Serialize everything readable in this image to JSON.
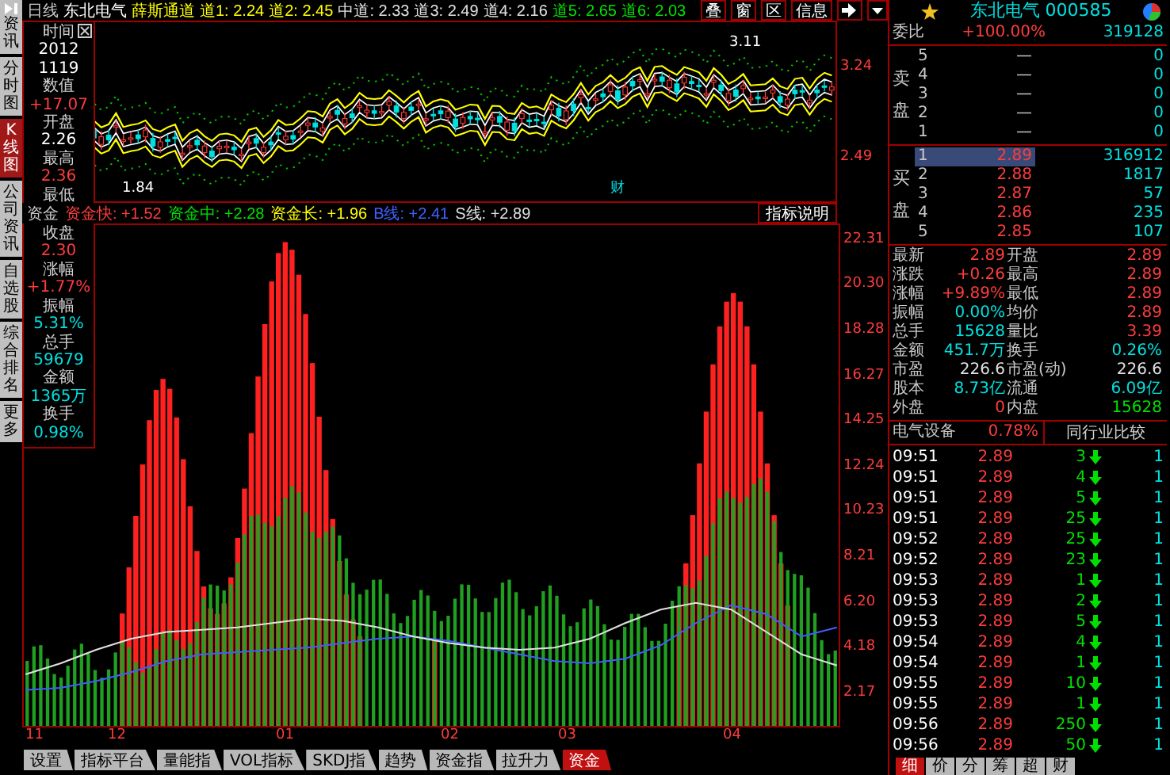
{
  "side_tabs": [
    {
      "label": "资讯",
      "icon": true,
      "selected": false
    },
    {
      "label": "分时图",
      "icon": false,
      "selected": false
    },
    {
      "label": "K线图",
      "icon": false,
      "selected": true
    },
    {
      "label": "公司资讯",
      "icon": false,
      "selected": false
    },
    {
      "label": "自选股",
      "icon": false,
      "selected": false
    },
    {
      "label": "综合排名",
      "icon": false,
      "selected": false
    },
    {
      "label": "更多",
      "icon": false,
      "selected": false
    }
  ],
  "header": {
    "period": "日线",
    "stock": "东北电气",
    "indicator": "薛斯通道",
    "values": [
      {
        "text": "道1: 2.24",
        "color": "#ffff00"
      },
      {
        "text": "道2: 2.45",
        "color": "#ffff00"
      },
      {
        "text": "中道: 2.33",
        "color": "#e0e0e0"
      },
      {
        "text": "道3: 2.49",
        "color": "#e0e0e0"
      },
      {
        "text": "道4: 2.16",
        "color": "#e0e0e0"
      },
      {
        "text": "道5: 2.65",
        "color": "#00e000"
      },
      {
        "text": "道6: 2.03",
        "color": "#00e000"
      }
    ],
    "buttons": [
      "叠",
      "窗",
      "区",
      "信息"
    ]
  },
  "price_chart": {
    "axis_labels": [
      "3.24",
      "2.49"
    ],
    "annotations": [
      {
        "kind": "high",
        "text": "3.11"
      },
      {
        "kind": "low",
        "text": "1.84"
      },
      {
        "kind": "mark",
        "text": "财"
      }
    ]
  },
  "info_panel": [
    {
      "label": "时间",
      "values": [
        {
          "text": "2012",
          "color": "#ffffff"
        },
        {
          "text": "1119",
          "color": "#ffffff"
        }
      ]
    },
    {
      "label": "数值",
      "values": [
        {
          "text": "+17.07",
          "color": "#ff3c3c"
        }
      ]
    },
    {
      "label": "开盘",
      "values": [
        {
          "text": "2.26",
          "color": "#ffffff"
        }
      ]
    },
    {
      "label": "最高",
      "values": [
        {
          "text": "2.36",
          "color": "#ff3c3c"
        }
      ]
    },
    {
      "label": "最低"
    },
    {
      "label": "收盘",
      "values": [
        {
          "text": "2.30",
          "color": "#ff3c3c"
        }
      ]
    },
    {
      "label": "涨幅",
      "values": [
        {
          "text": "+1.77%",
          "color": "#ff3c3c"
        }
      ]
    },
    {
      "label": "振幅",
      "values": [
        {
          "text": "5.31%",
          "color": "#00e0e0"
        }
      ]
    },
    {
      "label": "总手",
      "values": [
        {
          "text": "59679",
          "color": "#00e0e0"
        }
      ]
    },
    {
      "label": "金额",
      "values": [
        {
          "text": "1365万",
          "color": "#00e0e0"
        }
      ]
    },
    {
      "label": "换手",
      "values": [
        {
          "text": "0.98%",
          "color": "#00e0e0"
        }
      ]
    }
  ],
  "indicator_bar": {
    "name": "资金",
    "values": [
      {
        "text": "资金快: +1.52",
        "color": "#ff3c3c"
      },
      {
        "text": "资金中: +2.28",
        "color": "#00e000"
      },
      {
        "text": "资金长: +1.96",
        "color": "#ffff00"
      }
    ],
    "button": "指标说明"
  },
  "indicator_chart": {
    "chart_data": {
      "type": "line",
      "ylim": [
        0.6,
        23.0
      ],
      "yticks": [
        {
          "value": 22.31,
          "label": "22.31"
        },
        {
          "value": 20.3,
          "label": "20.30"
        },
        {
          "value": 18.28,
          "label": "18.28"
        },
        {
          "value": 16.27,
          "label": "16.27"
        },
        {
          "value": 14.25,
          "label": "14.25"
        },
        {
          "value": 12.24,
          "label": "12.24"
        },
        {
          "value": 10.23,
          "label": "10.23"
        },
        {
          "value": 8.21,
          "label": "8.21"
        },
        {
          "value": 6.2,
          "label": "6.20"
        },
        {
          "value": 4.18,
          "label": "4.18"
        },
        {
          "value": 2.17,
          "label": "2.17"
        }
      ],
      "series": [
        {
          "name": "B线: +2.41",
          "color": "#4060ff",
          "values": [
            2.2,
            2.3,
            2.6,
            3.0,
            3.5,
            3.8,
            3.9,
            4.0,
            4.1,
            4.3,
            4.5,
            4.6,
            4.4,
            4.1,
            3.8,
            3.5,
            3.4,
            3.6,
            4.2,
            5.2,
            6.0,
            5.6,
            4.6,
            5.0
          ]
        },
        {
          "name": "S线: +2.89",
          "color": "#e0e0e0",
          "values": [
            2.9,
            3.4,
            4.0,
            4.5,
            4.8,
            4.9,
            5.0,
            5.2,
            5.4,
            5.3,
            5.0,
            4.6,
            4.3,
            4.1,
            4.0,
            4.1,
            4.5,
            5.2,
            5.8,
            6.1,
            5.8,
            4.8,
            3.8,
            3.3
          ]
        }
      ]
    }
  },
  "x_axis": [
    "11",
    "12",
    "01",
    "02",
    "03",
    "04"
  ],
  "bottom_tabs": [
    {
      "label": "设置",
      "selected": false
    },
    {
      "label": "指标平台",
      "selected": false
    },
    {
      "label": "量能指",
      "selected": false
    },
    {
      "label": "VOL指标",
      "selected": false
    },
    {
      "label": "SKDJ指",
      "selected": false
    },
    {
      "label": "趋势",
      "selected": false
    },
    {
      "label": "资金指",
      "selected": false
    },
    {
      "label": "拉升力",
      "selected": false
    },
    {
      "label": "资金",
      "selected": true
    }
  ],
  "quote": {
    "title": "东北电气 000585",
    "ratio_label": "委比",
    "ratio": "+100.00%",
    "ratio_volume": "319128",
    "sell_label": "卖盘",
    "sell": [
      {
        "level": "5",
        "price": "—",
        "volume": "0",
        "selected": false
      },
      {
        "level": "4",
        "price": "—",
        "volume": "0",
        "selected": false
      },
      {
        "level": "3",
        "price": "—",
        "volume": "0",
        "selected": false
      },
      {
        "level": "2",
        "price": "—",
        "volume": "0",
        "selected": false
      },
      {
        "level": "1",
        "price": "—",
        "volume": "0",
        "selected": false
      }
    ],
    "buy_label": "买盘",
    "buy": [
      {
        "level": "1",
        "price": "2.89",
        "volume": "316912",
        "selected": true
      },
      {
        "level": "2",
        "price": "2.88",
        "volume": "1817",
        "selected": false
      },
      {
        "level": "3",
        "price": "2.87",
        "volume": "57",
        "selected": false
      },
      {
        "level": "4",
        "price": "2.86",
        "volume": "235",
        "selected": false
      },
      {
        "level": "5",
        "price": "2.85",
        "volume": "107",
        "selected": false
      }
    ],
    "stats": [
      [
        {
          "label": "最新",
          "value": "2.89",
          "color": "#ff3c3c"
        },
        {
          "label": "开盘",
          "value": "2.89",
          "color": "#ff3c3c"
        }
      ],
      [
        {
          "label": "涨跌",
          "value": "+0.26",
          "color": "#ff3c3c"
        },
        {
          "label": "最高",
          "value": "2.89",
          "color": "#ff3c3c"
        }
      ],
      [
        {
          "label": "涨幅",
          "value": "+9.89%",
          "color": "#ff3c3c"
        },
        {
          "label": "最低",
          "value": "2.89",
          "color": "#ff3c3c"
        }
      ],
      [
        {
          "label": "振幅",
          "value": "0.00%",
          "color": "#00e0e0"
        },
        {
          "label": "均价",
          "value": "2.89",
          "color": "#ff3c3c"
        }
      ],
      [
        {
          "label": "总手",
          "value": "15628",
          "color": "#00e0e0"
        },
        {
          "label": "量比",
          "value": "3.39",
          "color": "#ff3c3c"
        }
      ],
      [
        {
          "label": "金额",
          "value": "451.7万",
          "color": "#00e0e0"
        },
        {
          "label": "换手",
          "value": "0.26%",
          "color": "#00e0e0"
        }
      ],
      [
        {
          "label": "市盈",
          "value": "226.6",
          "color": "#e0e0e0"
        },
        {
          "label": "市盈(动)",
          "value": "226.6",
          "color": "#e0e0e0"
        }
      ],
      [
        {
          "label": "股本",
          "value": "8.73亿",
          "color": "#00e0e0"
        },
        {
          "label": "流通",
          "value": "6.09亿",
          "color": "#00e0e0"
        }
      ],
      [
        {
          "label": "外盘",
          "value": "0",
          "color": "#ff3c3c"
        },
        {
          "label": "内盘",
          "value": "15628",
          "color": "#00e000"
        }
      ]
    ],
    "industry": {
      "name": "电气设备",
      "change": "0.78%",
      "button": "同行业比较"
    },
    "trades": [
      {
        "time": "09:51",
        "price": "2.89",
        "volume": "3",
        "kind": "down",
        "column_4": "1"
      },
      {
        "time": "09:51",
        "price": "2.89",
        "volume": "4",
        "kind": "down",
        "column_4": "1"
      },
      {
        "time": "09:51",
        "price": "2.89",
        "volume": "5",
        "kind": "down",
        "column_4": "1"
      },
      {
        "time": "09:51",
        "price": "2.89",
        "volume": "25",
        "kind": "down",
        "column_4": "1"
      },
      {
        "time": "09:52",
        "price": "2.89",
        "volume": "25",
        "kind": "down",
        "column_4": "1"
      },
      {
        "time": "09:52",
        "price": "2.89",
        "volume": "23",
        "kind": "down",
        "column_4": "1"
      },
      {
        "time": "09:53",
        "price": "2.89",
        "volume": "1",
        "kind": "down",
        "column_4": "1"
      },
      {
        "time": "09:53",
        "price": "2.89",
        "volume": "2",
        "kind": "down",
        "column_4": "1"
      },
      {
        "time": "09:53",
        "price": "2.89",
        "volume": "5",
        "kind": "down",
        "column_4": "1"
      },
      {
        "time": "09:54",
        "price": "2.89",
        "volume": "4",
        "kind": "down",
        "column_4": "1"
      },
      {
        "time": "09:54",
        "price": "2.89",
        "volume": "1",
        "kind": "down",
        "column_4": "1"
      },
      {
        "time": "09:55",
        "price": "2.89",
        "volume": "10",
        "kind": "down",
        "column_4": "1"
      },
      {
        "time": "09:55",
        "price": "2.89",
        "volume": "1",
        "kind": "down",
        "column_4": "1"
      },
      {
        "time": "09:56",
        "price": "2.89",
        "volume": "250",
        "kind": "down",
        "column_4": "1"
      },
      {
        "time": "09:56",
        "price": "2.89",
        "volume": "50",
        "kind": "down",
        "column_4": "1"
      }
    ],
    "tabs": [
      {
        "label": "细",
        "selected": true
      },
      {
        "label": "价",
        "selected": false
      },
      {
        "label": "分",
        "selected": false
      },
      {
        "label": "筹",
        "selected": false
      },
      {
        "label": "超",
        "selected": false
      },
      {
        "label": "财",
        "selected": false
      }
    ]
  }
}
